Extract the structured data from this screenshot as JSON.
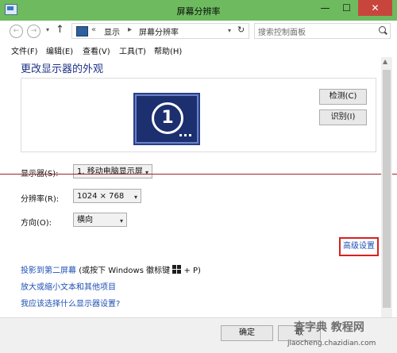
{
  "window": {
    "title": "屏幕分辨率",
    "min_glyph": "—",
    "max_glyph": "☐",
    "close_glyph": "✕"
  },
  "navbar": {
    "back_glyph": "←",
    "forward_glyph": "→",
    "dropdown_glyph": "▾",
    "up_glyph": "↑",
    "breadcrumb_sep": "«",
    "crumb_display": "显示",
    "crumb_arrow": "▸",
    "crumb_resolution": "屏幕分辨率",
    "address_dropdown_glyph": "▾",
    "refresh_glyph": "↻",
    "search_placeholder": "搜索控制面板"
  },
  "menu": [
    "文件(F)",
    "编辑(E)",
    "查看(V)",
    "工具(T)",
    "帮助(H)"
  ],
  "main": {
    "heading": "更改显示器的外观",
    "monitor_number": "1",
    "detect_label": "检测(C)",
    "identify_label": "识别(I)",
    "display_label": "显示器(S):",
    "display_value": "1. 移动电脑显示屏",
    "resolution_label": "分辨率(R):",
    "resolution_value": "1024 × 768",
    "orientation_label": "方向(O):",
    "orientation_value": "横向",
    "select_arrow": "▾",
    "advanced_link": "高级设置",
    "link_project": "投影到第二屏幕",
    "link_project_hint_pre": "(或按下 Windows 徽标键",
    "link_project_hint_post": "+ P)",
    "link_text_size": "放大或缩小文本和其他项目",
    "link_which_settings": "我应该选择什么显示器设置?"
  },
  "footer": {
    "ok_label": "确定",
    "cancel_label": "取"
  },
  "watermark": {
    "brand": "查字典 教程网",
    "site": "jiaocheng.chazidian.com"
  },
  "colors": {
    "titlebar": "#6dbb5e",
    "link": "#1e50b4",
    "heading": "#1e3287",
    "highlight_border": "#d8211f",
    "close_button": "#c8453d"
  }
}
